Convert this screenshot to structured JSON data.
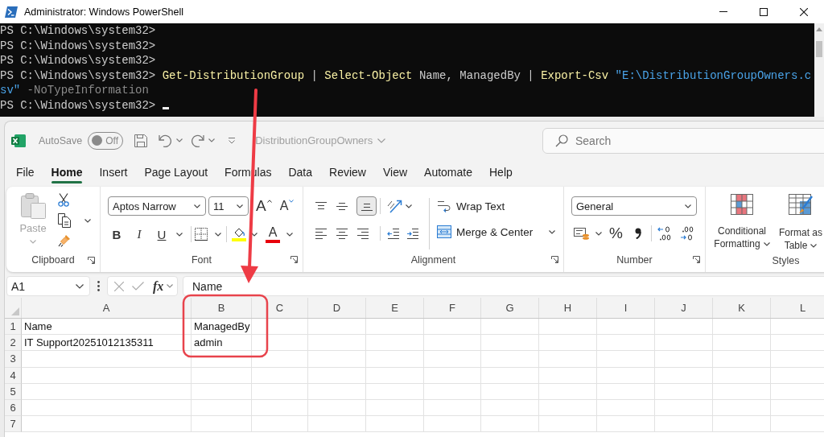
{
  "powershell": {
    "title": "Administrator: Windows PowerShell",
    "lines": [
      {
        "cursor": false,
        "segments": [
          {
            "kind": "prompt",
            "text": "PS C:\\Windows\\system32>"
          }
        ]
      },
      {
        "cursor": false,
        "segments": [
          {
            "kind": "prompt",
            "text": "PS C:\\Windows\\system32>"
          }
        ]
      },
      {
        "cursor": false,
        "segments": [
          {
            "kind": "prompt",
            "text": "PS C:\\Windows\\system32>"
          }
        ]
      },
      {
        "cursor": false,
        "segments": [
          {
            "kind": "prompt",
            "text": "PS C:\\Windows\\system32> "
          },
          {
            "kind": "cmdlet",
            "text": "Get-DistributionGroup"
          },
          {
            "kind": "plain",
            "text": " | "
          },
          {
            "kind": "cmdlet",
            "text": "Select-Object"
          },
          {
            "kind": "plain",
            "text": " Name, ManagedBy | "
          },
          {
            "kind": "cmdlet",
            "text": "Export-Csv"
          },
          {
            "kind": "string",
            "text": " \"E:\\DistributionGroupOwners.c"
          }
        ]
      },
      {
        "cursor": false,
        "segments": [
          {
            "kind": "string",
            "text": "sv\""
          },
          {
            "kind": "param",
            "text": " -NoTypeInformation"
          }
        ]
      },
      {
        "cursor": true,
        "segments": [
          {
            "kind": "prompt",
            "text": "PS C:\\Windows\\system32>"
          }
        ]
      }
    ]
  },
  "excel": {
    "title_bar": {
      "autosave_label": "AutoSave",
      "autosave": {
        "label": "Off",
        "on": false
      },
      "file_name": "DistributionGroupOwners",
      "search": {
        "placeholder": "Search"
      }
    },
    "tabs": [
      {
        "label": "File",
        "selected": false
      },
      {
        "label": "Home",
        "selected": true
      },
      {
        "label": "Insert",
        "selected": false
      },
      {
        "label": "Page Layout",
        "selected": false
      },
      {
        "label": "Formulas",
        "selected": false
      },
      {
        "label": "Data",
        "selected": false
      },
      {
        "label": "Review",
        "selected": false
      },
      {
        "label": "View",
        "selected": false
      },
      {
        "label": "Automate",
        "selected": false
      },
      {
        "label": "Help",
        "selected": false
      }
    ],
    "ribbon": {
      "clipboard": {
        "title": "Clipboard",
        "paste": {
          "label": "Paste",
          "disabled": true
        }
      },
      "font": {
        "title": "Font",
        "name": "Aptos Narrow",
        "size": "11",
        "grow": "A",
        "shrink": "A",
        "styles": [
          {
            "kind": "bold",
            "label": "B"
          },
          {
            "kind": "italic",
            "label": "I"
          },
          {
            "kind": "underline",
            "label": "U"
          }
        ],
        "font_color": "A"
      },
      "alignment": {
        "title": "Alignment",
        "vertical": [
          {
            "kind": "top",
            "selected": false
          },
          {
            "kind": "middle",
            "selected": false
          },
          {
            "kind": "bottom",
            "selected": true
          }
        ],
        "wrap_text": "Wrap Text",
        "merge": "Merge & Center"
      },
      "number": {
        "title": "Number",
        "format": "General",
        "percent": "%"
      },
      "styles": {
        "title": "Styles",
        "buttons": [
          {
            "kind": "conditional",
            "lines": [
              "Conditional",
              "Formatting"
            ]
          },
          {
            "kind": "table",
            "lines": [
              "Format as",
              "Table"
            ]
          }
        ]
      }
    },
    "formula_bar": {
      "name_box": "A1",
      "function_label": "fx",
      "formula": "Name"
    },
    "sheet": {
      "columns": [
        "A",
        "B",
        "C",
        "D",
        "E",
        "F",
        "G",
        "H",
        "I",
        "J",
        "K",
        "L"
      ],
      "rows": [
        {
          "number": "1",
          "cells": [
            "Name",
            "ManagedBy"
          ]
        },
        {
          "number": "2",
          "cells": [
            "IT Support20251012135311",
            "admin"
          ]
        },
        {
          "number": "3"
        },
        {
          "number": "4"
        },
        {
          "number": "5"
        },
        {
          "number": "6"
        },
        {
          "number": "7"
        }
      ]
    }
  }
}
